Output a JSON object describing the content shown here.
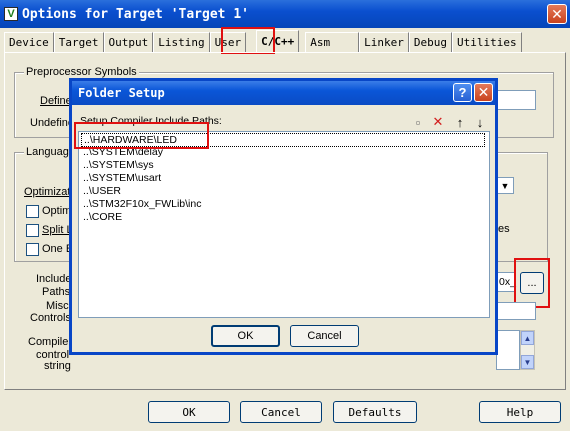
{
  "window": {
    "title": "Options for Target 'Target 1'",
    "app_icon": "V",
    "close_glyph": "✕"
  },
  "tabs": [
    "Device",
    "Target",
    "Output",
    "Listing",
    "User",
    "C/C++",
    "Asm",
    "Linker",
    "Debug",
    "Utilities"
  ],
  "active_tab": "C/C++",
  "background": {
    "preprocessor_legend": "Preprocessor Symbols",
    "define_label": "Define",
    "undefine_label": "Undefine",
    "language_legend": "Language",
    "optimization_label": "Optimization",
    "optim_label": "Optim",
    "split_label": "Split L",
    "one_label": "One E",
    "right_text": "es",
    "include_label": "Include",
    "paths_label": "Paths",
    "misc_label": "Misc",
    "controls_label": "Controls",
    "compiler_label": "Compiler",
    "control_label": "control",
    "string_label": "string",
    "include_value_fragment": "0x_",
    "browse_label": "..."
  },
  "dialog": {
    "title": "Folder Setup",
    "help_glyph": "?",
    "close_glyph": "✕",
    "list_label": "Setup Compiler Include Paths:",
    "paths": [
      "..\\HARDWARE\\LED",
      "..\\SYSTEM\\delay",
      "..\\SYSTEM\\sys",
      "..\\SYSTEM\\usart",
      "..\\USER",
      "..\\STM32F10x_FWLib\\inc",
      "..\\CORE"
    ],
    "ok_label": "OK",
    "cancel_label": "Cancel",
    "toolbar": {
      "new": "▫",
      "delete": "✕",
      "up": "↑",
      "down": "↓"
    }
  },
  "bottom_buttons": {
    "ok": "OK",
    "cancel": "Cancel",
    "defaults": "Defaults",
    "help": "Help"
  },
  "colors": {
    "title_blue": "#0a4fcf",
    "highlight_red": "#e01010",
    "face": "#ece9d8"
  }
}
